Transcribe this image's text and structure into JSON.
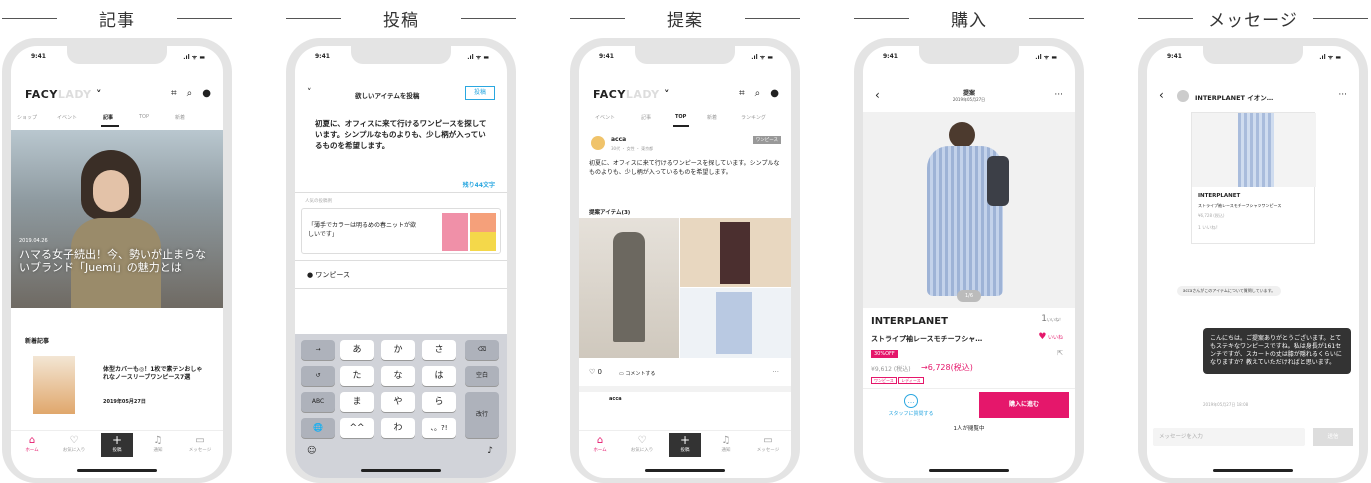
{
  "time": "9:41",
  "battery": ".ıl ᯤ ▬",
  "screens": {
    "article": {
      "section_title": "記事",
      "logo_main": "FACY",
      "logo_sub": "LADY",
      "tabs": [
        "ショップ",
        "イベント",
        "記事",
        "TOP",
        "新着"
      ],
      "hero_date": "2019.04.26",
      "hero_title": "ハマる女子続出！今、勢いが止まらないブランド「Juemi」の魅力とは",
      "new_label": "新着記事",
      "item_title": "体型カバーも◎！1枚で素テンおしゃれなノースリーブワンピース7選",
      "item_date": "2019年05月27日",
      "tabbar": [
        "ホーム",
        "お気に入り",
        "投稿",
        "通知",
        "メッセージ"
      ]
    },
    "post": {
      "section_title": "投稿",
      "header": "欲しいアイテムを投稿",
      "post_button": "投稿",
      "body": "初夏に、オフィスに来て行けるワンピースを探しています。シンプルなものよりも、少し柄が入っているものを希望します。",
      "remaining": "残り44文字",
      "popular_label": "人気の投稿例",
      "popular_text": "「薄手でカラーは明るめの春ニットが欲しいです」",
      "category": "ワンピース",
      "kbd_rows": [
        [
          "→",
          "あ",
          "か",
          "さ",
          "⌫"
        ],
        [
          "↺",
          "た",
          "な",
          "は",
          "空白"
        ],
        [
          "ABC",
          "ま",
          "や",
          "ら",
          "改行"
        ],
        [
          "🌐",
          "^^",
          "わ",
          "、。?!",
          ""
        ]
      ]
    },
    "proposal": {
      "section_title": "提案",
      "logo_main": "FACY",
      "logo_sub": "LADY",
      "tabs": [
        "イベント",
        "記事",
        "TOP",
        "新着",
        "ランキング"
      ],
      "user": "acca",
      "user_sub": "30代 ・ 女性 ・ 東京都",
      "badge": "ワンピース",
      "body": "初夏に、オフィスに来て行けるワンピースを探しています。シンプルなものよりも、少し柄が入っているものを希望します。",
      "items_label": "提案アイテム(3)",
      "likes": "0",
      "comment": "コメントする",
      "next_user": "acca",
      "tabbar": [
        "ホーム",
        "お気に入り",
        "投稿",
        "通知",
        "メッセージ"
      ]
    },
    "purchase": {
      "section_title": "購入",
      "header_title": "提案",
      "header_date": "2019年05月27日",
      "counter": "1/6",
      "brand": "INTERPLANET",
      "likes": "1",
      "likes_unit": "いいね！",
      "like_label": "いいね",
      "name": "ストライプ袖レースモチーフシャ…",
      "discount": "30%OFF",
      "old_price": "¥9,612 (税込)",
      "new_price": "→6,728(税込)",
      "tags": [
        "ワンピース",
        "レディース"
      ],
      "ask_label": "スタッフに質問する",
      "buy_label": "購入に進む",
      "viewers": "1人が閲覧中"
    },
    "message": {
      "section_title": "メッセージ",
      "header": "INTERPLANET イオン…",
      "card_brand": "INTERPLANET",
      "card_name": "ストライプ袖レースモチーフシャツワンピース",
      "card_price": "¥6,728 (税込)",
      "card_likes": "1 いいね！",
      "system_note": "accaさんがこのアイテムについて質問しています。",
      "message": "こんにちは。ご提案ありがとうございます。とてもステキなワンピースですね。私は身長が161センチですが、スカートの丈は膝が隠れるくらいになりますか？教えていただければと思います。",
      "message_time": "2019年05月27日 18:08",
      "input_placeholder": "メッセージを入力",
      "send": "送信"
    }
  },
  "colors": {
    "accent": "#e5176b",
    "link": "#2aa7e0",
    "frame": "#e4e4e4"
  }
}
